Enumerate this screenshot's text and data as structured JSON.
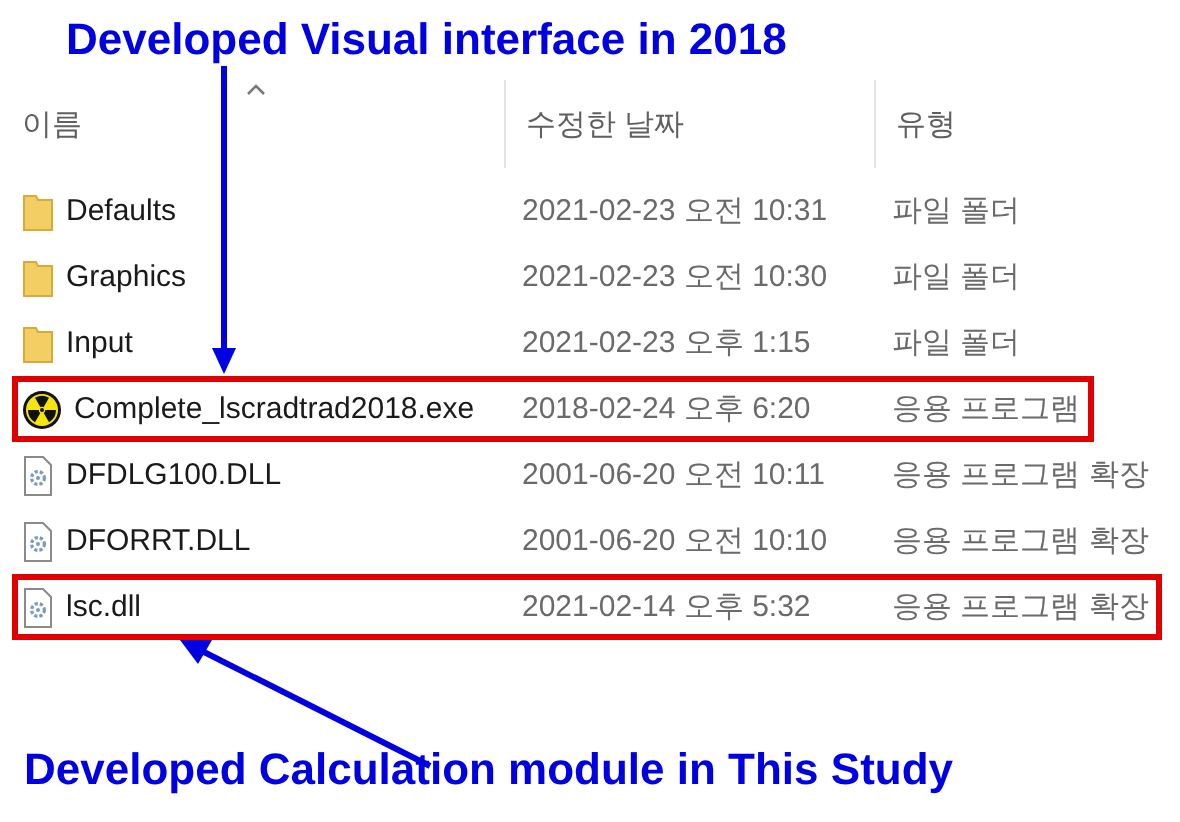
{
  "annotations": {
    "top": "Developed Visual interface in 2018",
    "bottom": "Developed Calculation module in This Study"
  },
  "columns": [
    {
      "label": "이름",
      "sorted": true
    },
    {
      "label": "수정한 날짜",
      "sorted": false
    },
    {
      "label": "유형",
      "sorted": false
    }
  ],
  "rows": [
    {
      "kind": "folder",
      "name": "Defaults",
      "date": "2021-02-23 오전 10:31",
      "type": "파일 폴더",
      "highlighted": false
    },
    {
      "kind": "folder",
      "name": "Graphics",
      "date": "2021-02-23 오전 10:30",
      "type": "파일 폴더",
      "highlighted": false
    },
    {
      "kind": "folder",
      "name": "Input",
      "date": "2021-02-23 오후 1:15",
      "type": "파일 폴더",
      "highlighted": false
    },
    {
      "kind": "exe",
      "name": "Complete_lscradtrad2018.exe",
      "date": "2018-02-24 오후 6:20",
      "type": "응용 프로그램",
      "highlighted": true
    },
    {
      "kind": "dll",
      "name": "DFDLG100.DLL",
      "date": "2001-06-20 오전 10:11",
      "type": "응용 프로그램 확장",
      "highlighted": false
    },
    {
      "kind": "dll",
      "name": "DFORRT.DLL",
      "date": "2001-06-20 오전 10:10",
      "type": "응용 프로그램 확장",
      "highlighted": false
    },
    {
      "kind": "dll",
      "name": "lsc.dll",
      "date": "2021-02-14 오후 5:32",
      "type": "응용 프로그램 확장",
      "highlighted": true
    }
  ]
}
